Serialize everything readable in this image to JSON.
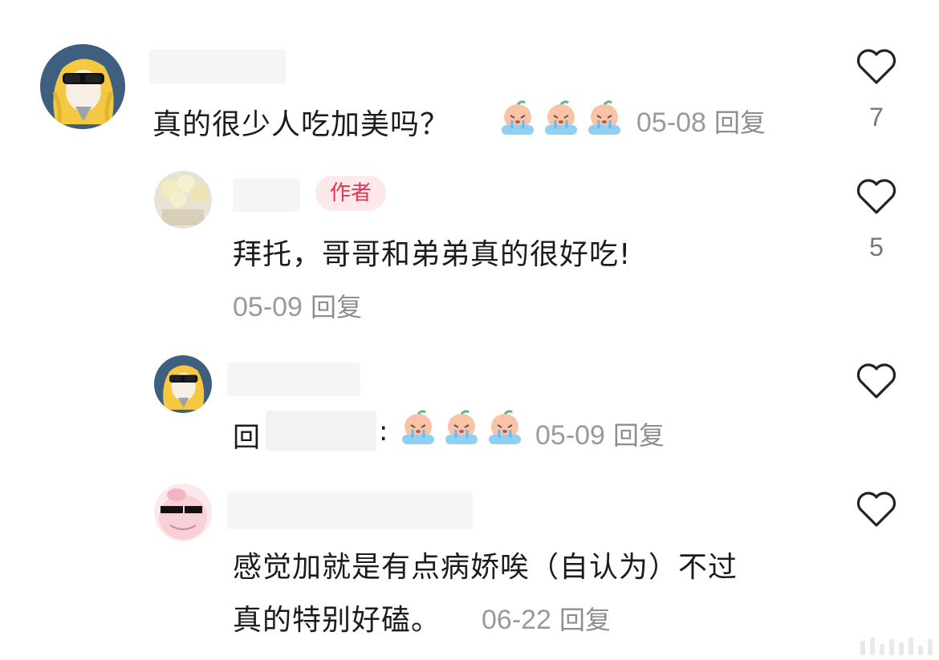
{
  "comments": [
    {
      "avatar": "blonde-sunglasses-avatar",
      "text": "真的很少人吃加美吗？",
      "emojis": [
        "crying-peach-emoji",
        "crying-peach-emoji",
        "crying-peach-emoji"
      ],
      "date": "05-08",
      "reply_label": "回复",
      "likes": "7"
    },
    {
      "avatar": "flowers-avatar",
      "badge": "作者",
      "text": "拜托，哥哥和弟弟真的很好吃!",
      "date": "05-09",
      "reply_label": "回复",
      "likes": "5"
    },
    {
      "avatar": "blonde-sunglasses-avatar",
      "reply_prefix": "回",
      "colon": ":",
      "emojis": [
        "crying-peach-emoji",
        "crying-peach-emoji",
        "crying-peach-emoji"
      ],
      "date": "05-09",
      "reply_label": "回复",
      "likes": ""
    },
    {
      "avatar": "pink-sunglasses-avatar",
      "text_line1": "感觉加就是有点病娇唉（自认为）不过",
      "text_line2": "真的特别好磕。",
      "date": "06-22",
      "reply_label": "回复",
      "likes": ""
    }
  ],
  "colors": {
    "badge_text": "#e8334f",
    "badge_bg": "#fde8ec",
    "meta_text": "#9a9a9a"
  }
}
